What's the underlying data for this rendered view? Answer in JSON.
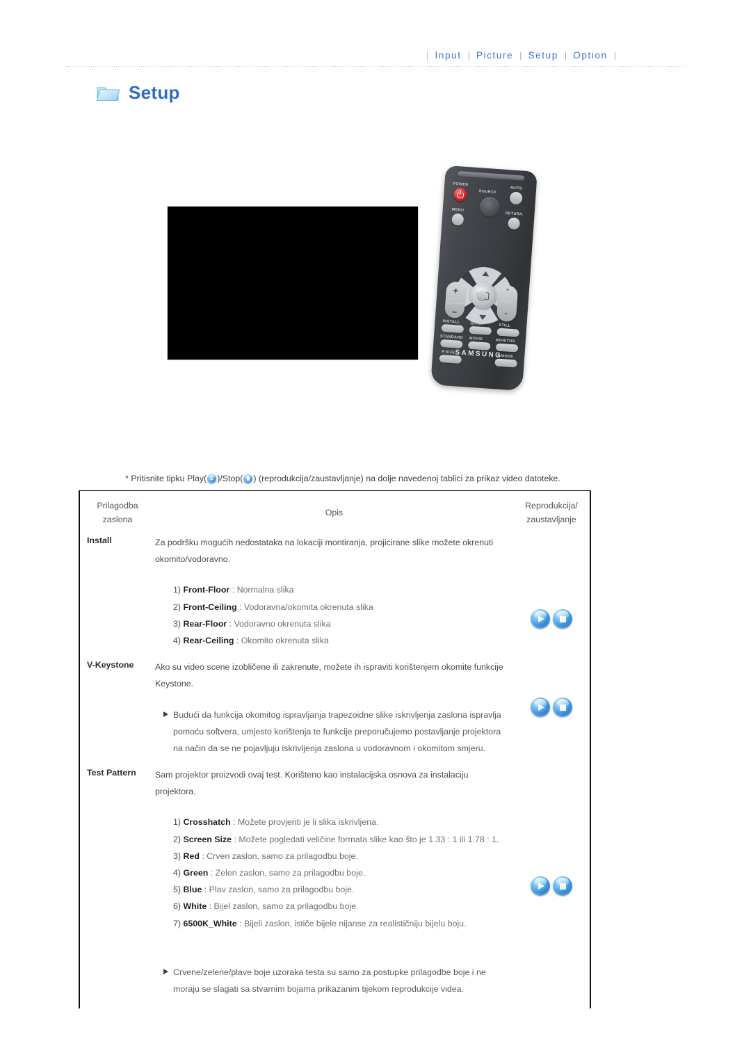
{
  "nav": {
    "separator": "|",
    "items": [
      {
        "label": "Input"
      },
      {
        "label": "Picture"
      },
      {
        "label": "Setup"
      },
      {
        "label": "Option"
      }
    ]
  },
  "page": {
    "title": "Setup",
    "title_color": "#2f6cc4",
    "folder_icon": "folder-icon"
  },
  "media": {
    "screenshot_alt": "projector-osd-screenshot",
    "remote": {
      "brand": "SAMSUNG",
      "labels": {
        "power": "POWER",
        "source": "SOURCE",
        "mute": "MUTE",
        "menu": "MENU",
        "return": "RETURN",
        "exit": "EXIT",
        "vol": "VOL",
        "still_keystone": "STILL\nKEYSTONE",
        "still_keystone_line1": "STILL",
        "still_keystone_line2": "KEYSTONE",
        "install": "INSTALL",
        "quick": "QUICK",
        "still": "STILL",
        "standard": "STANDARD",
        "movie": "MOVIE",
        "monitor": "MONITOR",
        "p_size": "P.SIZE",
        "p_mode": "P.MODE",
        "plus": "+",
        "minus": "−",
        "chevron_up": "⌃",
        "chevron_down": "⌄"
      }
    }
  },
  "note": {
    "prefix": "* Pritisnite tipku Play(",
    "mid": ")/Stop(",
    "suffix": ") (reprodukcija/zaustavljanje) na dolje navedenoj tablici za prikaz video datoteke."
  },
  "table": {
    "headers": {
      "col1_line1": "Prilagodba",
      "col1_line2": "zaslona",
      "col2": "Opis",
      "col3_line1": "Reprodukcija/",
      "col3_line2": "zaustavljanje"
    },
    "rows": [
      {
        "label": "Install",
        "lead": "Za podršku mogućih nedostataka na lokaciji montiranja, projicirane slike možete okrenuti okomito/vodoravno.",
        "items": [
          {
            "num": "1)",
            "term": "Front-Floor",
            "colon": " : ",
            "text": "Normalna slika"
          },
          {
            "num": "2)",
            "term": "Front-Ceiling",
            "colon": " : ",
            "text": "Vodoravna/okomita okrenuta slika"
          },
          {
            "num": "3)",
            "term": "Rear-Floor",
            "colon": " : ",
            "text": "Vodoravno okrenuta slika"
          },
          {
            "num": "4)",
            "term": "Rear-Ceiling",
            "colon": " : ",
            "text": "Okomito okrenuta slika"
          }
        ],
        "bullets": [],
        "controls": [
          "play",
          "stop"
        ]
      },
      {
        "label": "V-Keystone",
        "lead": "Ako su video scene izobličene ili zakrenute, možete ih ispraviti korištenjem okomite funkcije Keystone.",
        "items": [],
        "bullets": [
          "Budući da funkcija okomitog ispravljanja trapezoidne slike iskrivljenja zaslona ispravlja pomoću softvera, umjesto korištenja te funkcije preporučujemo postavljanje projektora na način da se ne pojavljuju iskrivljenja zaslona u vodoravnom i okomitom smjeru."
        ],
        "controls": [
          "play",
          "stop"
        ]
      },
      {
        "label": "Test Pattern",
        "lead": "Sam projektor proizvodi ovaj test. Korišteno kao instalacijska osnova za instalaciju projektora.",
        "items": [
          {
            "num": "1)",
            "term": "Crosshatch",
            "colon": " : ",
            "text": "Možete provjeriti je li slika iskrivljena."
          },
          {
            "num": "2)",
            "term": "Screen Size",
            "colon": " : ",
            "text": "Možete pogledati veličine formata slike kao što je 1.33 : 1 ili 1.78 : 1."
          },
          {
            "num": "3)",
            "term": "Red",
            "colon": " : ",
            "text": "Crven zaslon, samo za prilagodbu boje."
          },
          {
            "num": "4)",
            "term": "Green",
            "colon": " : ",
            "text": "Zelen zaslon, samo za prilagodbu boje."
          },
          {
            "num": "5)",
            "term": "Blue",
            "colon": " : ",
            "text": "Plav zaslon, samo za prilagodbu boje."
          },
          {
            "num": "6)",
            "term": "White",
            "colon": " : ",
            "text": "Bijel zaslon, samo za prilagodbu boje."
          },
          {
            "num": "7)",
            "term": "6500K_White",
            "colon": " : ",
            "text": "Bijeli zaslon, ističe bijele nijanse za realističniju bijelu boju."
          }
        ],
        "bullets": [
          "Crvene/zelene/plave boje uzoraka testa su samo za postupke prilagodbe boje i ne moraju se slagati sa stvarnim bojama prikazanim tijekom reprodukcije videa."
        ],
        "controls": [
          "play",
          "stop"
        ]
      }
    ]
  }
}
